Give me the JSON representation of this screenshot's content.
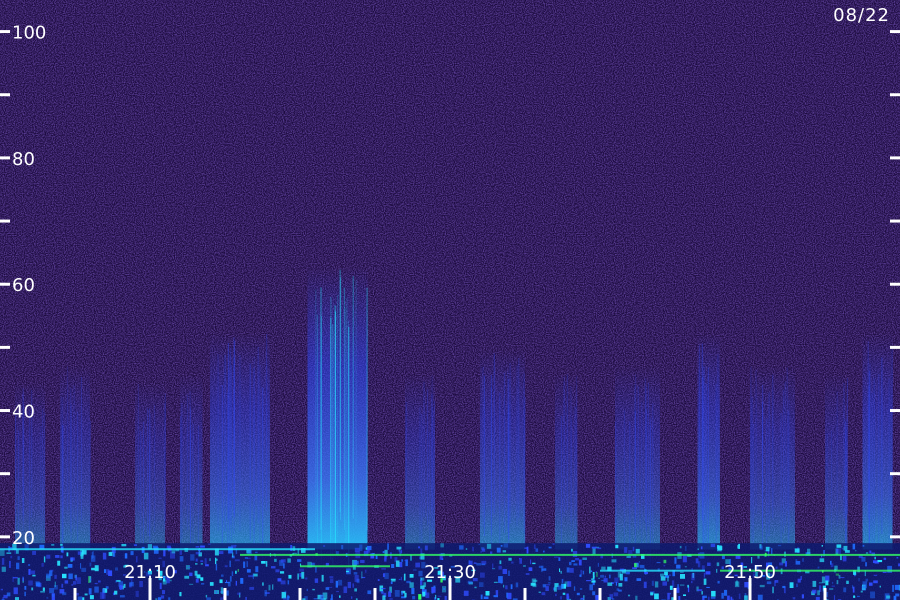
{
  "chart_data": {
    "type": "heatmap",
    "date_label": "08/22",
    "y_axis": {
      "tick_labels": [
        "20",
        "40",
        "60",
        "80",
        "100"
      ],
      "major_ticks": [
        20,
        40,
        60,
        80,
        100
      ],
      "minor_ticks": [
        30,
        50,
        70,
        90
      ],
      "range": [
        10,
        105
      ]
    },
    "x_axis": {
      "tick_labels": [
        "21:10",
        "21:30",
        "21:50"
      ],
      "labeled_ticks": [
        10,
        30,
        50
      ],
      "minor_ticks": [
        5,
        10,
        15,
        20,
        25,
        30,
        35,
        40,
        45,
        50,
        55
      ],
      "range": [
        0,
        60
      ]
    },
    "colors": {
      "background": "#1c0b3f",
      "low": "#2a1470",
      "mid": "#2f4cff",
      "high": "#27e3ff",
      "peak": "#33ff66"
    },
    "activity_bands": [
      {
        "start": 1,
        "end": 3,
        "intensity": 0.25
      },
      {
        "start": 4,
        "end": 6,
        "intensity": 0.35
      },
      {
        "start": 9,
        "end": 11,
        "intensity": 0.25
      },
      {
        "start": 12,
        "end": 13.5,
        "intensity": 0.3
      },
      {
        "start": 14,
        "end": 18,
        "intensity": 0.55
      },
      {
        "start": 20.5,
        "end": 24.5,
        "intensity": 0.95
      },
      {
        "start": 27,
        "end": 29,
        "intensity": 0.3
      },
      {
        "start": 32,
        "end": 35,
        "intensity": 0.45
      },
      {
        "start": 37,
        "end": 38.5,
        "intensity": 0.3
      },
      {
        "start": 41,
        "end": 44,
        "intensity": 0.35
      },
      {
        "start": 46.5,
        "end": 48,
        "intensity": 0.55
      },
      {
        "start": 50,
        "end": 53,
        "intensity": 0.35
      },
      {
        "start": 55,
        "end": 56.5,
        "intensity": 0.3
      },
      {
        "start": 57.5,
        "end": 59.5,
        "intensity": 0.55
      }
    ]
  }
}
